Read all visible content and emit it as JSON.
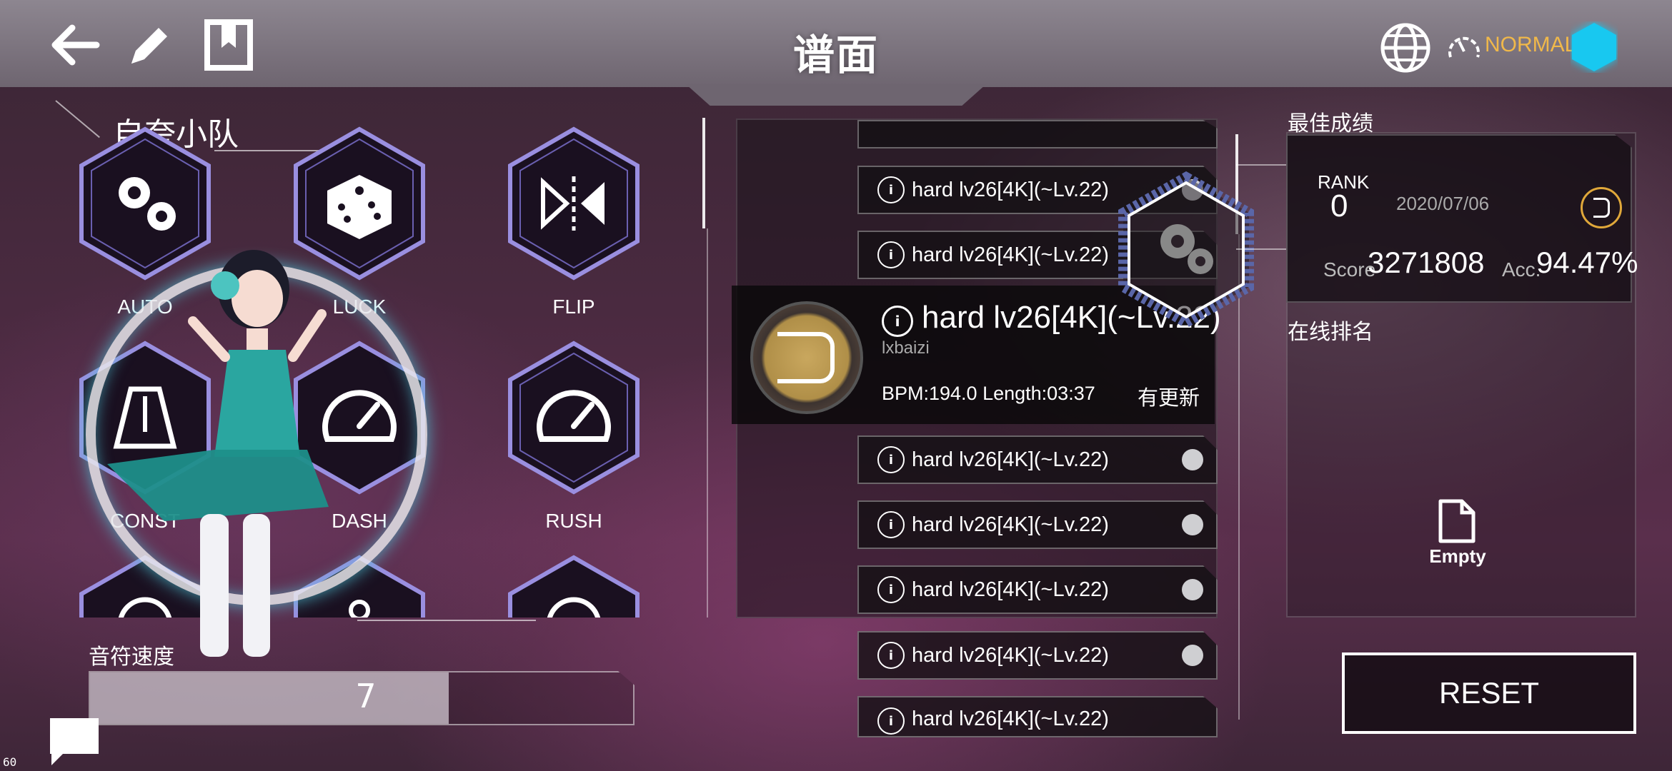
{
  "header": {
    "title": "谱面",
    "difficulty_label": "NORMAL"
  },
  "team": {
    "title": "自夸小队"
  },
  "mods": [
    {
      "label": "AUTO",
      "icon": "gears-icon"
    },
    {
      "label": "LUCK",
      "icon": "dice-icon"
    },
    {
      "label": "FLIP",
      "icon": "flip-icon"
    },
    {
      "label": "CONST",
      "icon": "metronome-icon"
    },
    {
      "label": "DASH",
      "icon": "speedometer-icon"
    },
    {
      "label": "RUSH",
      "icon": "gauge-icon"
    }
  ],
  "note_speed": {
    "label": "音符速度",
    "value": "7",
    "fill_fraction": 0.66
  },
  "song_list": {
    "items_above": [
      {
        "text": "hard lv26[4K](~Lv.22)"
      },
      {
        "text": "hard lv26[4K](~Lv.22)"
      }
    ],
    "selected": {
      "title": "hard lv26[4K](~Lv.22)",
      "author": "lxbaizi",
      "meta": "BPM:194.0  Length:03:37",
      "update": "有更新"
    },
    "items_below": [
      {
        "text": "hard lv26[4K](~Lv.22)"
      },
      {
        "text": "hard lv26[4K](~Lv.22)"
      },
      {
        "text": "hard lv26[4K](~Lv.22)"
      },
      {
        "text": "hard lv26[4K](~Lv.22)"
      },
      {
        "text": "hard lv26[4K](~Lv.22)"
      }
    ]
  },
  "best": {
    "title": "最佳成绩",
    "rank_label": "RANK",
    "rank_value": "0",
    "date": "2020/07/06",
    "score_label": "Score",
    "score_value": "3271808",
    "acc_label": "Acc.",
    "acc_value": "94.47%"
  },
  "online": {
    "title": "在线排名",
    "empty_label": "Empty"
  },
  "reset_label": "RESET",
  "fps": "60",
  "colors": {
    "accent_orange": "#f0b84a",
    "accent_cyan": "#18c8f0",
    "hex_border": "#9a8fe0"
  }
}
